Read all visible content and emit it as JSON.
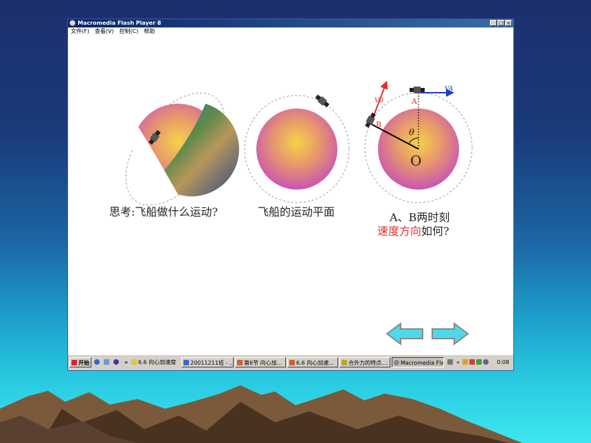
{
  "window": {
    "title": "Macromedia Flash Player 8",
    "controls": [
      "_",
      "□",
      "×"
    ]
  },
  "menu": [
    "文件(F)",
    "查看(V)",
    "控制(C)",
    "帮助"
  ],
  "panels": [
    {
      "caption": "思考:飞船做什么运动?"
    },
    {
      "caption": "飞船的运动平面"
    },
    {
      "caption_line1": "A、B两时刻",
      "caption_red": "速度方向",
      "caption_rest": "如何?",
      "labels": {
        "va": "VA",
        "vb": "VB",
        "a": "A",
        "b": "B",
        "theta": "θ",
        "o": "O"
      }
    }
  ],
  "nav": {
    "prev": "previous-arrow",
    "next": "next-arrow"
  },
  "taskbar": {
    "start": "开始",
    "overflow": "»",
    "items": [
      "6.6 向心加速度",
      "20011211班 - ...",
      "第6节 向心加...",
      "6.6 向心加速...",
      "合外力的特点....",
      "Macromedia Fla..."
    ],
    "tray_chevron": "«",
    "clock": "0:08"
  },
  "colors": {
    "accent_red": "#e03030",
    "arrow_blue": "#1a3cc8",
    "nav_cyan": "#4fd8ea"
  }
}
